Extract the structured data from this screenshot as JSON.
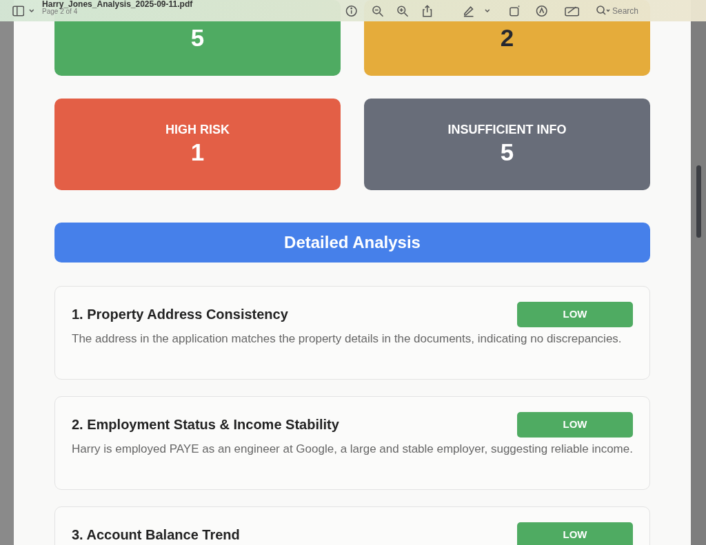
{
  "toolbar": {
    "title": "Harry_Jones_Analysis_2025-09-11.pdf",
    "page_indicator": "Page 2 of 4",
    "search": {
      "placeholder": "Search"
    }
  },
  "summary_cards": [
    {
      "value": "5",
      "color": "#4fab62"
    },
    {
      "value": "2",
      "color": "#e5ac3b"
    },
    {
      "label": "HIGH RISK",
      "value": "1",
      "color": "#e35f46"
    },
    {
      "label": "INSUFFICIENT INFO",
      "value": "5",
      "color": "#686d79"
    }
  ],
  "section_header": "Detailed Analysis",
  "analysis_items": [
    {
      "title": "1. Property Address Consistency",
      "risk": "LOW",
      "color": "#4fab62",
      "description": "The address in the application matches the property details in the documents, indicating no discrepancies."
    },
    {
      "title": "2. Employment Status & Income Stability",
      "risk": "LOW",
      "color": "#4fab62",
      "description": "Harry is employed PAYE as an engineer at Google, a large and stable employer, suggesting reliable income."
    },
    {
      "title": "3. Account Balance Trend",
      "risk": "LOW",
      "color": "#4fab62"
    }
  ]
}
